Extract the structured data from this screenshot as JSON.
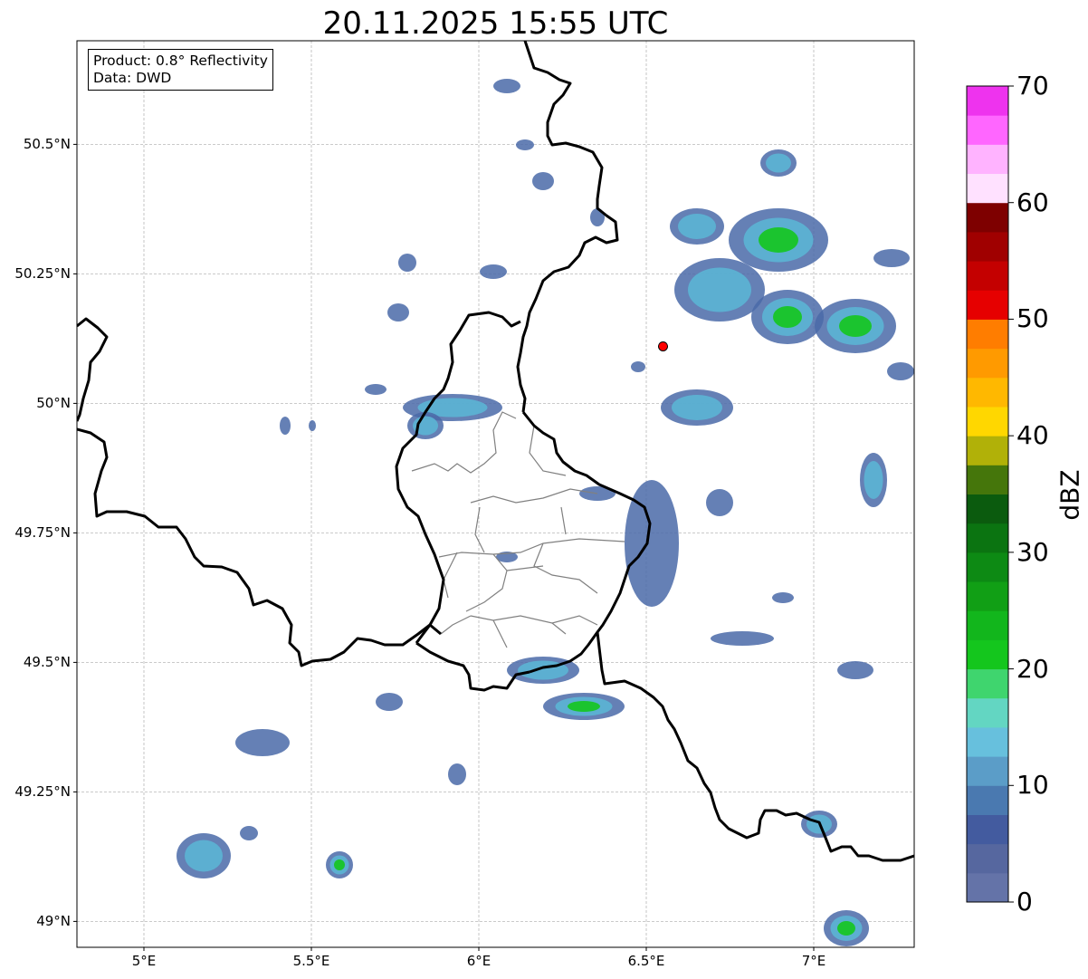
{
  "title": "20.11.2025 15:55 UTC",
  "info": {
    "product": "Product: 0.8° Reflectivity",
    "source": "Data: DWD"
  },
  "axes": {
    "lat_labels": [
      "50.5°N",
      "50.25°N",
      "50°N",
      "49.75°N",
      "49.5°N",
      "49.25°N",
      "49°N"
    ],
    "lon_labels": [
      "5°E",
      "5.5°E",
      "6°E",
      "6.5°E",
      "7°E"
    ],
    "lat_range": [
      48.95,
      50.7
    ],
    "lon_range": [
      4.8,
      7.3
    ],
    "grid": true
  },
  "colorbar": {
    "unit": "dBZ",
    "tick_labels": [
      "0",
      "10",
      "20",
      "30",
      "40",
      "50",
      "60",
      "70"
    ],
    "range": [
      0,
      70
    ],
    "step": 2.5,
    "colors": [
      "#6473a8",
      "#56679f",
      "#435b9f",
      "#4a79b0",
      "#5b9dc8",
      "#67c0dd",
      "#63d6c2",
      "#3fd56e",
      "#14c61d",
      "#12b61c",
      "#119f15",
      "#0d8a14",
      "#0b7411",
      "#0b5b0e",
      "#45760b",
      "#b1b108",
      "#ffd700",
      "#ffb800",
      "#ff9a00",
      "#ff7d00",
      "#e60000",
      "#c40000",
      "#a00000",
      "#7e0000",
      "#ffe1ff",
      "#ffb3ff",
      "#ff66ff",
      "#ee33ee"
    ]
  },
  "marker": {
    "lat": 50.11,
    "lon": 6.55,
    "color": "#ff0000"
  },
  "echo_colors": [
    "#4a6aa8",
    "#5bb4d4",
    "#3fd56e",
    "#14c61d",
    "#0b7411"
  ]
}
